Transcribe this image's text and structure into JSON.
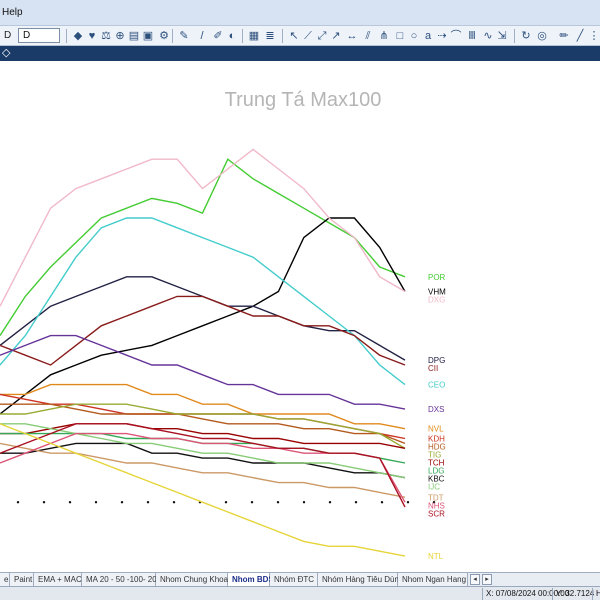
{
  "menubar": {
    "help": "Help"
  },
  "toolbar": {
    "label": "D",
    "interval": "D"
  },
  "chart_data": {
    "type": "line",
    "title": "Trung Tá Max100",
    "x": [
      0,
      1,
      2,
      3,
      4,
      5,
      6,
      7,
      8,
      9,
      10,
      11,
      12,
      13,
      14,
      15,
      16
    ],
    "series": [
      {
        "name": "POR",
        "color": "#44cc33",
        "values": [
          46,
          54,
          60,
          65,
          70,
          72,
          74,
          73,
          71,
          82,
          78,
          75,
          72,
          69,
          66,
          60,
          58
        ]
      },
      {
        "name": "VHM",
        "color": "#000000",
        "values": [
          30,
          34,
          38,
          40,
          42,
          43,
          44,
          46,
          48,
          50,
          52,
          55,
          66,
          70,
          70,
          64,
          55
        ]
      },
      {
        "name": "DXG",
        "color": "#f0b8c8",
        "values": [
          52,
          62,
          72,
          76,
          78,
          80,
          82,
          82,
          76,
          80,
          84,
          80,
          76,
          70,
          66,
          58,
          55
        ]
      },
      {
        "name": "DPG",
        "color": "#222244",
        "values": [
          44,
          48,
          52,
          54,
          56,
          58,
          58,
          56,
          54,
          52,
          52,
          50,
          48,
          47,
          47,
          44,
          41
        ]
      },
      {
        "name": "CEO",
        "color": "#44cccc",
        "values": [
          40,
          46,
          54,
          62,
          68,
          70,
          70,
          68,
          66,
          64,
          62,
          58,
          54,
          50,
          46,
          40,
          36
        ]
      },
      {
        "name": "CII",
        "color": "#8a1b1b",
        "values": [
          44,
          42,
          40,
          44,
          48,
          50,
          52,
          54,
          54,
          52,
          50,
          50,
          48,
          48,
          46,
          42,
          40
        ]
      },
      {
        "name": "DXS",
        "color": "#663399",
        "values": [
          42,
          44,
          46,
          46,
          44,
          42,
          40,
          40,
          38,
          36,
          36,
          34,
          34,
          34,
          32,
          32,
          31
        ]
      },
      {
        "name": "NVL",
        "color": "#e08a1e",
        "values": [
          34,
          34,
          36,
          36,
          36,
          36,
          34,
          34,
          32,
          32,
          30,
          30,
          30,
          30,
          28,
          28,
          27
        ]
      },
      {
        "name": "KDH",
        "color": "#cc3322",
        "values": [
          34,
          33,
          32,
          32,
          31,
          30,
          30,
          30,
          30,
          30,
          30,
          29,
          29,
          28,
          27,
          26,
          25
        ]
      },
      {
        "name": "HDG",
        "color": "#b45a1e",
        "values": [
          32,
          32,
          32,
          31,
          30,
          30,
          30,
          30,
          29,
          28,
          28,
          28,
          27,
          27,
          26,
          26,
          24
        ]
      },
      {
        "name": "TIG",
        "color": "#99aa33",
        "values": [
          30,
          30,
          31,
          32,
          32,
          32,
          31,
          30,
          30,
          30,
          30,
          29,
          29,
          28,
          27,
          26,
          23
        ]
      },
      {
        "name": "KBC",
        "color": "#111111",
        "values": [
          22,
          22,
          23,
          24,
          24,
          24,
          22,
          22,
          21,
          21,
          20,
          20,
          20,
          19,
          18,
          18,
          17
        ]
      },
      {
        "name": "TCH",
        "color": "#990000",
        "values": [
          26,
          26,
          27,
          28,
          28,
          28,
          27,
          27,
          26,
          26,
          25,
          25,
          24,
          24,
          24,
          24,
          23
        ]
      },
      {
        "name": "LDG",
        "color": "#33aa55",
        "values": [
          26,
          26,
          26,
          26,
          26,
          25,
          25,
          25,
          24,
          24,
          24,
          23,
          23,
          22,
          22,
          21,
          20
        ]
      },
      {
        "name": "IJC",
        "color": "#88cc77",
        "values": [
          28,
          28,
          27,
          26,
          25,
          24,
          24,
          23,
          22,
          22,
          21,
          20,
          20,
          20,
          19,
          18,
          17
        ]
      },
      {
        "name": "TDT",
        "color": "#cc9966",
        "values": [
          24,
          23,
          22,
          22,
          21,
          20,
          20,
          19,
          18,
          18,
          17,
          16,
          16,
          15,
          15,
          14,
          13
        ]
      },
      {
        "name": "NHS",
        "color": "#dd5577",
        "values": [
          20,
          22,
          24,
          26,
          26,
          26,
          25,
          25,
          24,
          24,
          23,
          23,
          22,
          22,
          22,
          21,
          12
        ]
      },
      {
        "name": "SCR",
        "color": "#aa1122",
        "values": [
          22,
          24,
          26,
          28,
          28,
          28,
          27,
          26,
          25,
          25,
          24,
          23,
          23,
          22,
          22,
          21,
          11
        ]
      },
      {
        "name": "NTL",
        "color": "#e6d43a",
        "values": [
          28,
          26,
          24,
          22,
          20,
          18,
          16,
          14,
          12,
          10,
          8,
          6,
          4,
          3,
          3,
          2,
          1
        ]
      }
    ],
    "dotted_row_value": 12,
    "ylim": [
      0,
      100
    ],
    "grid": false,
    "legend": "right-labels"
  },
  "tabs": {
    "items": [
      {
        "label": "e",
        "active": false
      },
      {
        "label": "Paint",
        "active": false
      },
      {
        "label": "EMA + MACD",
        "active": false
      },
      {
        "label": "MA 20 - 50 -100- 200",
        "active": false
      },
      {
        "label": "Nhom Chung Khoan",
        "active": false
      },
      {
        "label": "Nhom BDS",
        "active": true
      },
      {
        "label": "Nhóm ĐTC",
        "active": false
      },
      {
        "label": "Nhóm Hàng Tiêu Dùng",
        "active": false
      },
      {
        "label": "Nhom Ngan Hang",
        "active": false
      }
    ]
  },
  "status": {
    "x": "X: 07/08/2024 00:00:00",
    "y": "Y: 32.7124",
    "extra": "H"
  }
}
